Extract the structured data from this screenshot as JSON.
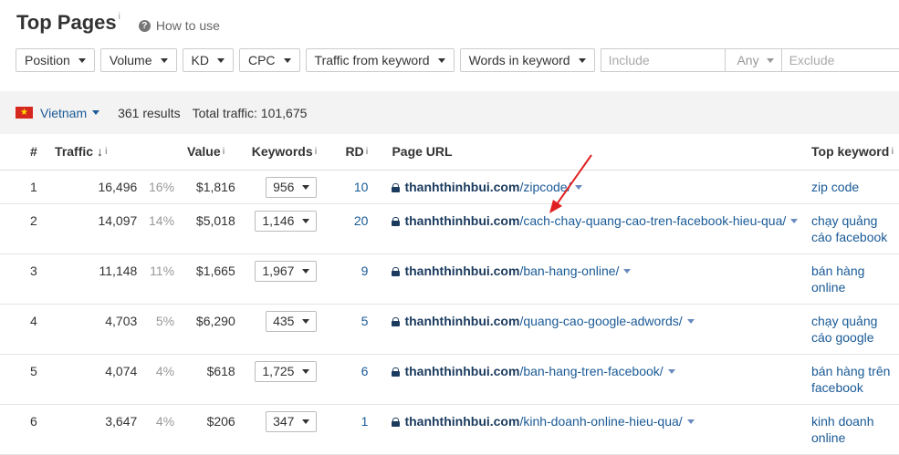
{
  "header": {
    "title": "Top Pages",
    "info_mark": "i",
    "how_to_use": "How to use",
    "help_glyph": "?"
  },
  "filters": {
    "buttons": [
      "Position",
      "Volume",
      "KD",
      "CPC",
      "Traffic from keyword",
      "Words in keyword"
    ],
    "include_placeholder": "Include",
    "any_label": "Any",
    "exclude_placeholder": "Exclude"
  },
  "summary": {
    "country": "Vietnam",
    "flag_star": "★",
    "results": "361 results",
    "total_traffic": "Total traffic: 101,675"
  },
  "table": {
    "headers": {
      "num": "#",
      "traffic": "Traffic",
      "sort_arrow": "↓",
      "value": "Value",
      "keywords": "Keywords",
      "rd": "RD",
      "url": "Page URL",
      "top_keyword": "Top keyword",
      "info_mark": "i"
    },
    "rows": [
      {
        "num": "1",
        "traffic": "16,496",
        "pct": "16%",
        "value": "$1,816",
        "keywords": "956",
        "rd": "10",
        "domain": "thanhthinhbui.com",
        "path": "/zipcode/",
        "top_keyword": "zip code"
      },
      {
        "num": "2",
        "traffic": "14,097",
        "pct": "14%",
        "value": "$5,018",
        "keywords": "1,146",
        "rd": "20",
        "domain": "thanhthinhbui.com",
        "path": "/cach-chay-quang-cao-tren-facebook-hieu-qua/",
        "top_keyword": "chạy quảng cáo facebook"
      },
      {
        "num": "3",
        "traffic": "11,148",
        "pct": "11%",
        "value": "$1,665",
        "keywords": "1,967",
        "rd": "9",
        "domain": "thanhthinhbui.com",
        "path": "/ban-hang-online/",
        "top_keyword": "bán hàng online"
      },
      {
        "num": "4",
        "traffic": "4,703",
        "pct": "5%",
        "value": "$6,290",
        "keywords": "435",
        "rd": "5",
        "domain": "thanhthinhbui.com",
        "path": "/quang-cao-google-adwords/",
        "top_keyword": "chạy quảng cáo google"
      },
      {
        "num": "5",
        "traffic": "4,074",
        "pct": "4%",
        "value": "$618",
        "keywords": "1,725",
        "rd": "6",
        "domain": "thanhthinhbui.com",
        "path": "/ban-hang-tren-facebook/",
        "top_keyword": "bán hàng trên facebook"
      },
      {
        "num": "6",
        "traffic": "3,647",
        "pct": "4%",
        "value": "$206",
        "keywords": "347",
        "rd": "1",
        "domain": "thanhthinhbui.com",
        "path": "/kinh-doanh-online-hieu-qua/",
        "top_keyword": "kinh doanh online"
      }
    ]
  },
  "colors": {
    "link": "#1a5a96",
    "domain": "#1a3a5e",
    "annotation_arrow": "#e02020",
    "flag_red": "#d7281f",
    "flag_star": "#ffde00"
  }
}
